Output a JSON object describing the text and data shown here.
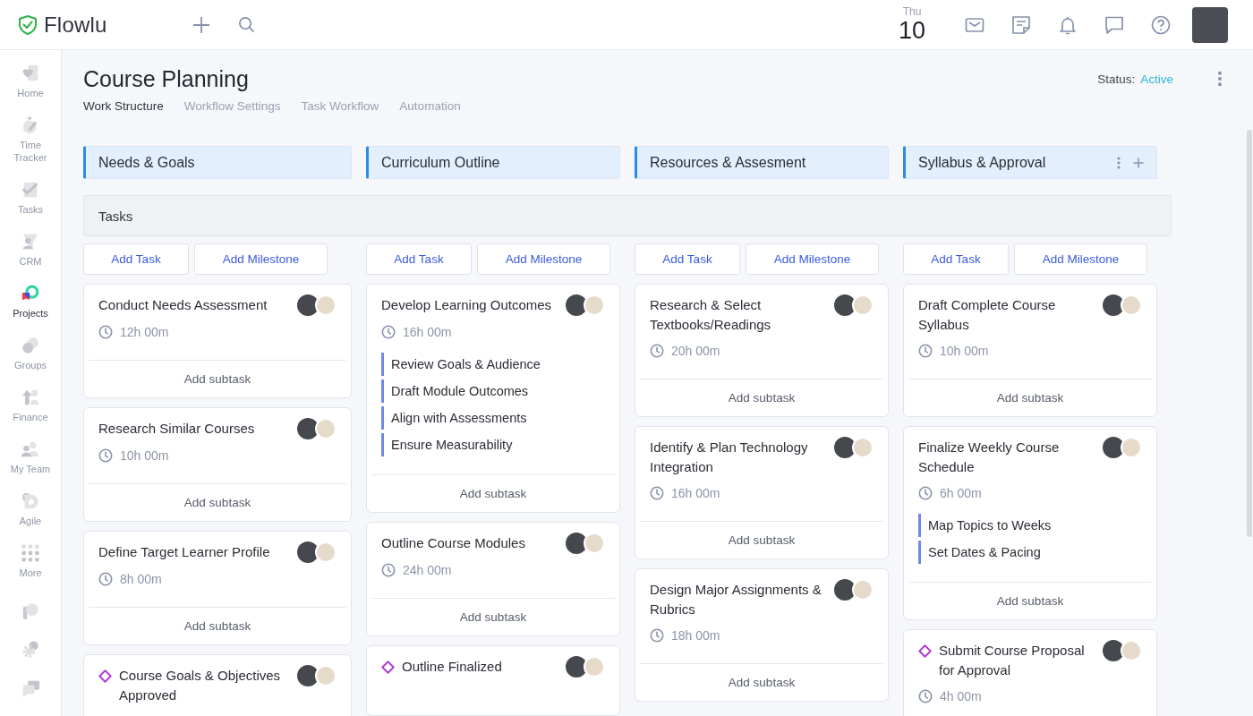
{
  "topbar": {
    "logo": "Flowlu",
    "date": {
      "weekday": "Thu",
      "day": "10"
    }
  },
  "sidebar": {
    "items": [
      {
        "label": "Home",
        "selected": false
      },
      {
        "label": "Time Tracker",
        "selected": false
      },
      {
        "label": "Tasks",
        "selected": false
      },
      {
        "label": "CRM",
        "selected": false
      },
      {
        "label": "Projects",
        "selected": true
      },
      {
        "label": "Groups",
        "selected": false
      },
      {
        "label": "Finance",
        "selected": false
      },
      {
        "label": "My Team",
        "selected": false
      },
      {
        "label": "Agile",
        "selected": false
      },
      {
        "label": "More",
        "selected": false
      }
    ]
  },
  "header": {
    "title": "Course Planning",
    "tabs": [
      {
        "label": "Work Structure",
        "selected": true
      },
      {
        "label": "Workflow Settings",
        "selected": false
      },
      {
        "label": "Task Workflow",
        "selected": false
      },
      {
        "label": "Automation",
        "selected": false
      }
    ],
    "status": {
      "label": "Status:",
      "value": "Active"
    }
  },
  "board": {
    "lane": "Tasks",
    "columns": [
      {
        "title": "Needs & Goals",
        "actions_shown": false,
        "add_task": "Add Task",
        "add_milestone": "Add Milestone",
        "cards": [
          {
            "kind": "task",
            "title": "Conduct Needs Assessment",
            "time": "12h 00m",
            "add_subtask": "Add subtask"
          },
          {
            "kind": "task",
            "title": "Research Similar Courses",
            "time": "10h 00m",
            "add_subtask": "Add subtask"
          },
          {
            "kind": "task",
            "title": "Define Target Learner Profile",
            "time": "8h 00m",
            "add_subtask": "Add subtask"
          },
          {
            "kind": "milestone",
            "title": "Course Goals & Objectives Approved"
          }
        ]
      },
      {
        "title": "Curriculum Outline",
        "actions_shown": false,
        "add_task": "Add Task",
        "add_milestone": "Add Milestone",
        "cards": [
          {
            "kind": "task",
            "title": "Develop Learning Outcomes",
            "time": "16h 00m",
            "subtasks": [
              "Review Goals & Audience",
              "Draft Module Outcomes",
              "Align with Assessments",
              "Ensure Measurability"
            ],
            "add_subtask": "Add subtask"
          },
          {
            "kind": "task",
            "title": "Outline Course Modules",
            "time": "24h 00m",
            "add_subtask": "Add subtask"
          },
          {
            "kind": "milestone",
            "title": "Outline Finalized"
          }
        ]
      },
      {
        "title": "Resources & Assesment",
        "actions_shown": false,
        "add_task": "Add Task",
        "add_milestone": "Add Milestone",
        "cards": [
          {
            "kind": "task",
            "title": "Research & Select Textbooks/Readings",
            "time": "20h 00m",
            "add_subtask": "Add subtask"
          },
          {
            "kind": "task",
            "title": "Identify & Plan Technology Integration",
            "time": "16h 00m",
            "add_subtask": "Add subtask"
          },
          {
            "kind": "task",
            "title": "Design Major Assignments & Rubrics",
            "time": "18h 00m",
            "add_subtask": "Add subtask"
          }
        ]
      },
      {
        "title": "Syllabus & Approval",
        "actions_shown": true,
        "add_task": "Add Task",
        "add_milestone": "Add Milestone",
        "cards": [
          {
            "kind": "task",
            "title": "Draft Complete Course Syllabus",
            "time": "10h 00m",
            "add_subtask": "Add subtask"
          },
          {
            "kind": "task",
            "title": "Finalize Weekly Course Schedule",
            "time": "6h 00m",
            "subtasks": [
              "Map Topics to Weeks",
              "Set Dates & Pacing"
            ],
            "add_subtask": "Add subtask"
          },
          {
            "kind": "milestone",
            "title": "Submit Course Proposal for Approval",
            "time": "4h 00m"
          }
        ]
      }
    ]
  }
}
